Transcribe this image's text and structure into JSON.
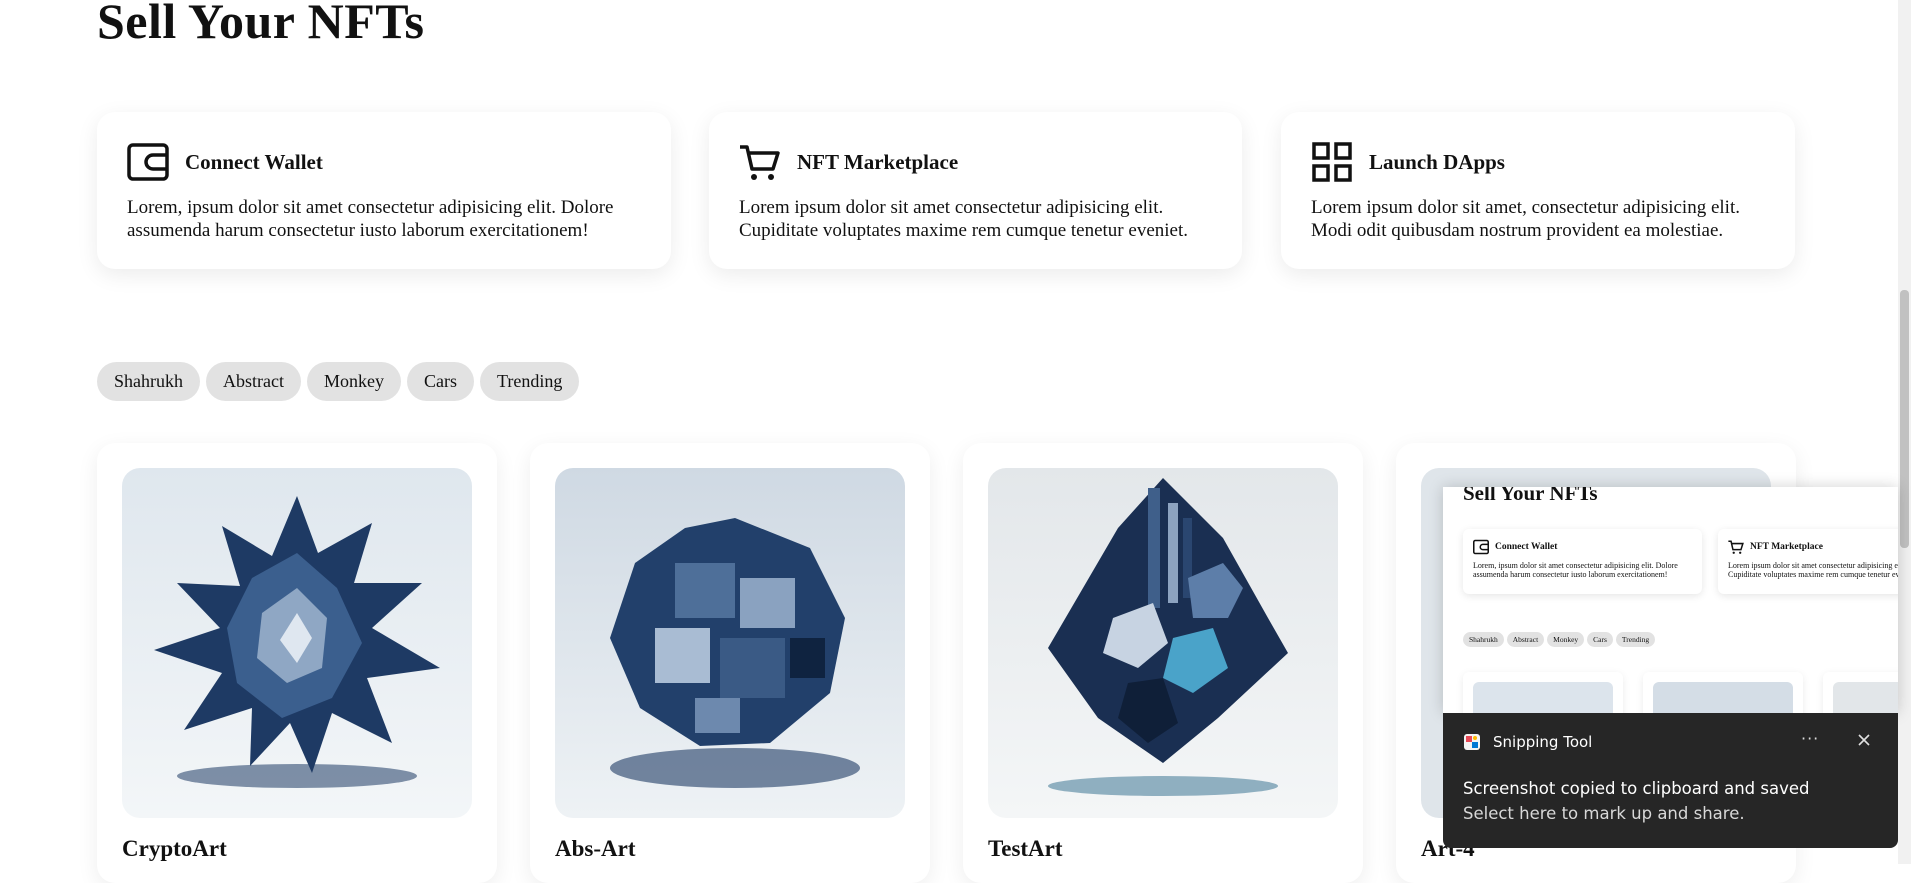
{
  "page": {
    "title": "Sell Your NFTs"
  },
  "features": [
    {
      "icon": "wallet-icon",
      "title": "Connect Wallet",
      "line1": "Lorem, ipsum dolor sit amet consectetur adipisicing elit. Dolore",
      "line2": "assumenda harum consectetur iusto laborum exercitationem!"
    },
    {
      "icon": "shopping-cart-icon",
      "title": "NFT Marketplace",
      "line1": "Lorem ipsum dolor sit amet consectetur adipisicing elit.",
      "line2": "Cupiditate voluptates maxime rem cumque tenetur eveniet."
    },
    {
      "icon": "grid-apps-icon",
      "title": "Launch DApps",
      "line1": "Lorem ipsum dolor sit amet, consectetur adipisicing elit.",
      "line2": "Modi odit quibusdam nostrum provident ea molestiae."
    }
  ],
  "filters": [
    "Shahrukh",
    "Abstract",
    "Monkey",
    "Cars",
    "Trending"
  ],
  "nfts": [
    {
      "title": "CryptoArt"
    },
    {
      "title": "Abs-Art"
    },
    {
      "title": "TestArt"
    },
    {
      "title": "Art-4"
    }
  ],
  "snipping_tool": {
    "app_name": "Snipping Tool",
    "more_label": "···",
    "message_line1": "Screenshot copied to clipboard and saved",
    "message_line2": "Select here to mark up and share.",
    "preview": {
      "title": "Sell Your NFTs",
      "card1_title": "Connect Wallet",
      "card1_line1": "Lorem, ipsum dolor sit amet consectetur adipisicing elit. Dolore",
      "card1_line2": "assumenda harum consectetur iusto laborum exercitationem!",
      "card2_title": "NFT Marketplace",
      "card2_line1": "Lorem ipsum dolor sit amet consectetur adipisicing elit.",
      "card2_line2": "Cupiditate voluptates maxime rem cumque tenetur eveniet.",
      "chips": [
        "Shahrukh",
        "Abstract",
        "Monkey",
        "Cars",
        "Trending"
      ]
    }
  },
  "colors": {
    "chip_bg": "#e2e2e2",
    "toast_bg": "#262626",
    "art_blue": "#1e3a64"
  }
}
